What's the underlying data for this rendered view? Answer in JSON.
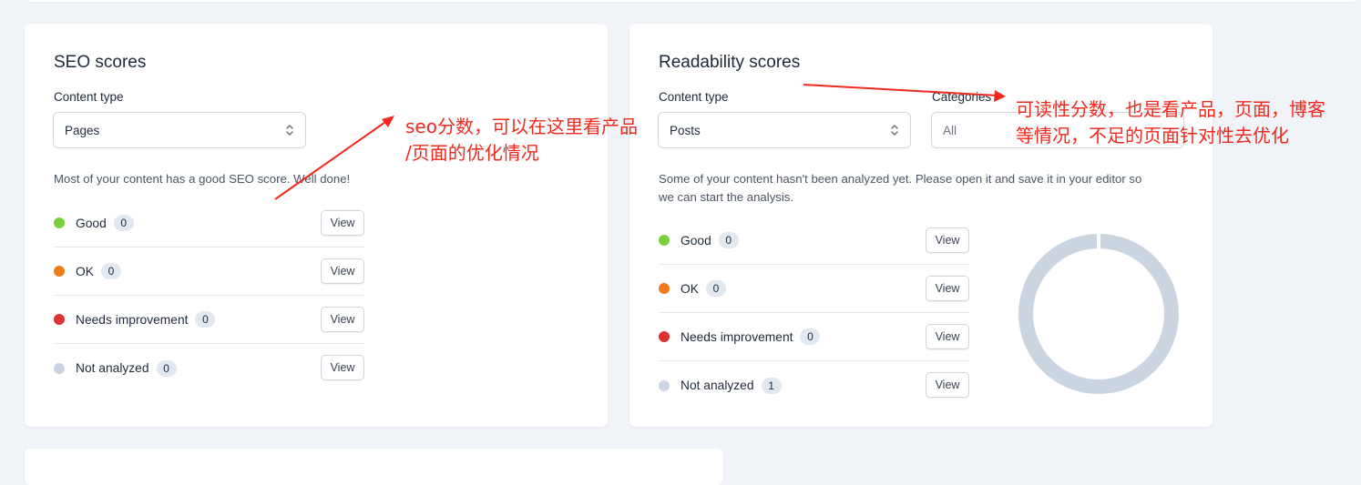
{
  "seo": {
    "title": "SEO scores",
    "content_type_label": "Content type",
    "content_type_value": "Pages",
    "message": "Most of your content has a good SEO score. Well done!",
    "rows": [
      {
        "label": "Good",
        "count": "0",
        "color": "#7ad03a",
        "view": "View"
      },
      {
        "label": "OK",
        "count": "0",
        "color": "#ee7c1b",
        "view": "View"
      },
      {
        "label": "Needs improvement",
        "count": "0",
        "color": "#dc3232",
        "view": "View"
      },
      {
        "label": "Not analyzed",
        "count": "0",
        "color": "#cbd5e1",
        "view": "View"
      }
    ]
  },
  "readability": {
    "title": "Readability scores",
    "content_type_label": "Content type",
    "content_type_value": "Posts",
    "categories_label": "Categories",
    "categories_value": "All",
    "message_line1": "Some of your content hasn't been analyzed yet. Please open it and save it in your editor so",
    "message_line2": "we can start the analysis.",
    "rows": [
      {
        "label": "Good",
        "count": "0",
        "color": "#7ad03a",
        "view": "View"
      },
      {
        "label": "OK",
        "count": "0",
        "color": "#ee7c1b",
        "view": "View"
      },
      {
        "label": "Needs improvement",
        "count": "0",
        "color": "#dc3232",
        "view": "View"
      },
      {
        "label": "Not analyzed",
        "count": "1",
        "color": "#cbd5e1",
        "view": "View"
      }
    ],
    "donut_color": "#cbd5e1"
  },
  "annotations": {
    "seo_line1": "seo分数，可以在这里看产品",
    "seo_line2": "/页面的优化情况",
    "read_line1": "可读性分数，也是看产品，页面，博客",
    "read_line2": "等情况，不足的页面针对性去优化",
    "color": "#f0281e"
  }
}
